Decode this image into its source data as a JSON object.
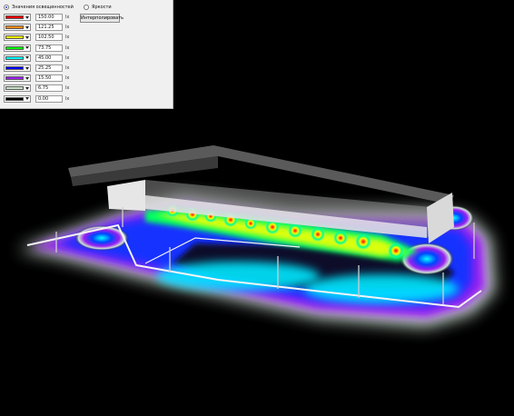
{
  "mode_options": [
    {
      "label": "Значения освещенностей",
      "selected": true
    },
    {
      "label": "Яркости",
      "selected": false
    }
  ],
  "interpolate_label": "Интерполировать",
  "legend": [
    {
      "color": "#ff0000",
      "value": "150.00",
      "unit": "lx"
    },
    {
      "color": "#ff8c1a",
      "value": "121.25",
      "unit": "lx"
    },
    {
      "color": "#ffff00",
      "value": "102.50",
      "unit": "lx"
    },
    {
      "color": "#00ff00",
      "value": "73.75",
      "unit": "lx"
    },
    {
      "color": "#00ffff",
      "value": "45.00",
      "unit": "lx"
    },
    {
      "color": "#0000ff",
      "value": "25.25",
      "unit": "lx"
    },
    {
      "color": "#a020f0",
      "value": "15.50",
      "unit": "lx"
    },
    {
      "color": "#c8e0c8",
      "value": "6.75",
      "unit": "lx"
    },
    {
      "color": "#000000",
      "value": "0.00",
      "unit": "lx"
    }
  ],
  "icons": {
    "dropdown": "chevron-down-icon",
    "radio": "radio-icon"
  }
}
